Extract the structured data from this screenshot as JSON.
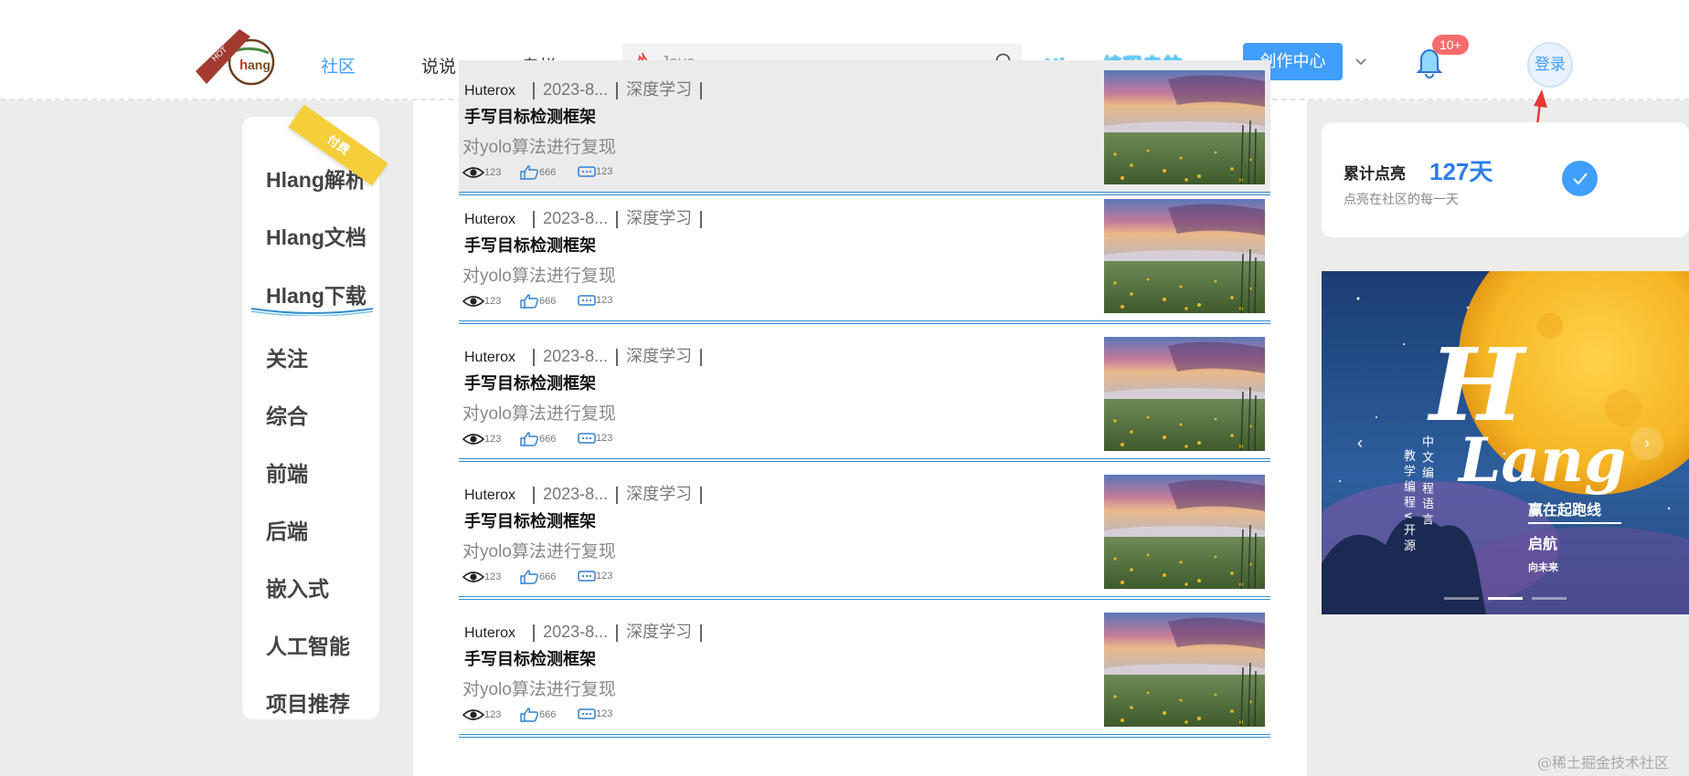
{
  "header": {
    "nav": [
      "社区",
      "说说",
      "专栏"
    ],
    "search_placeholder": "Java",
    "brand_title": "Hlang编程启航",
    "create_label": "创作中心",
    "notif_count": "10+",
    "login_label": "登录",
    "logo_hot": "HOT",
    "logo_text": "hang"
  },
  "sidebar": {
    "ribbon": "付费",
    "items": [
      "Hlang解析",
      "Hlang文档",
      "Hlang下载",
      "关注",
      "综合",
      "前端",
      "后端",
      "嵌入式",
      "人工智能",
      "项目推荐"
    ]
  },
  "articles": [
    {
      "author": "Huterox",
      "date": "2023-8...",
      "tag": "深度学习",
      "title": "手写目标检测框架",
      "desc": "对yolo算法进行复现",
      "views": "123",
      "likes": "666",
      "comments": "123"
    },
    {
      "author": "Huterox",
      "date": "2023-8...",
      "tag": "深度学习",
      "title": "手写目标检测框架",
      "desc": "对yolo算法进行复现",
      "views": "123",
      "likes": "666",
      "comments": "123"
    },
    {
      "author": "Huterox",
      "date": "2023-8...",
      "tag": "深度学习",
      "title": "手写目标检测框架",
      "desc": "对yolo算法进行复现",
      "views": "123",
      "likes": "666",
      "comments": "123"
    },
    {
      "author": "Huterox",
      "date": "2023-8...",
      "tag": "深度学习",
      "title": "手写目标检测框架",
      "desc": "对yolo算法进行复现",
      "views": "123",
      "likes": "666",
      "comments": "123"
    },
    {
      "author": "Huterox",
      "date": "2023-8...",
      "tag": "深度学习",
      "title": "手写目标检测框架",
      "desc": "对yolo算法进行复现",
      "views": "123",
      "likes": "666",
      "comments": "123"
    }
  ],
  "streak": {
    "label": "累计点亮",
    "days": "127天",
    "sub": "点亮在社区的每一天"
  },
  "banner": {
    "big1": "H",
    "big2": "Lang",
    "vert1": "中文编程语言",
    "vert2": "教学编程∨开源",
    "slogan": "赢在起跑线",
    "go": "启航",
    "future": "向未来",
    "prev": "‹",
    "next": "›"
  },
  "watermark": "@稀土掘金技术社区",
  "colors": {
    "accent": "#409eff",
    "badge": "#f56c6c",
    "divider": "#2f8fd0"
  }
}
